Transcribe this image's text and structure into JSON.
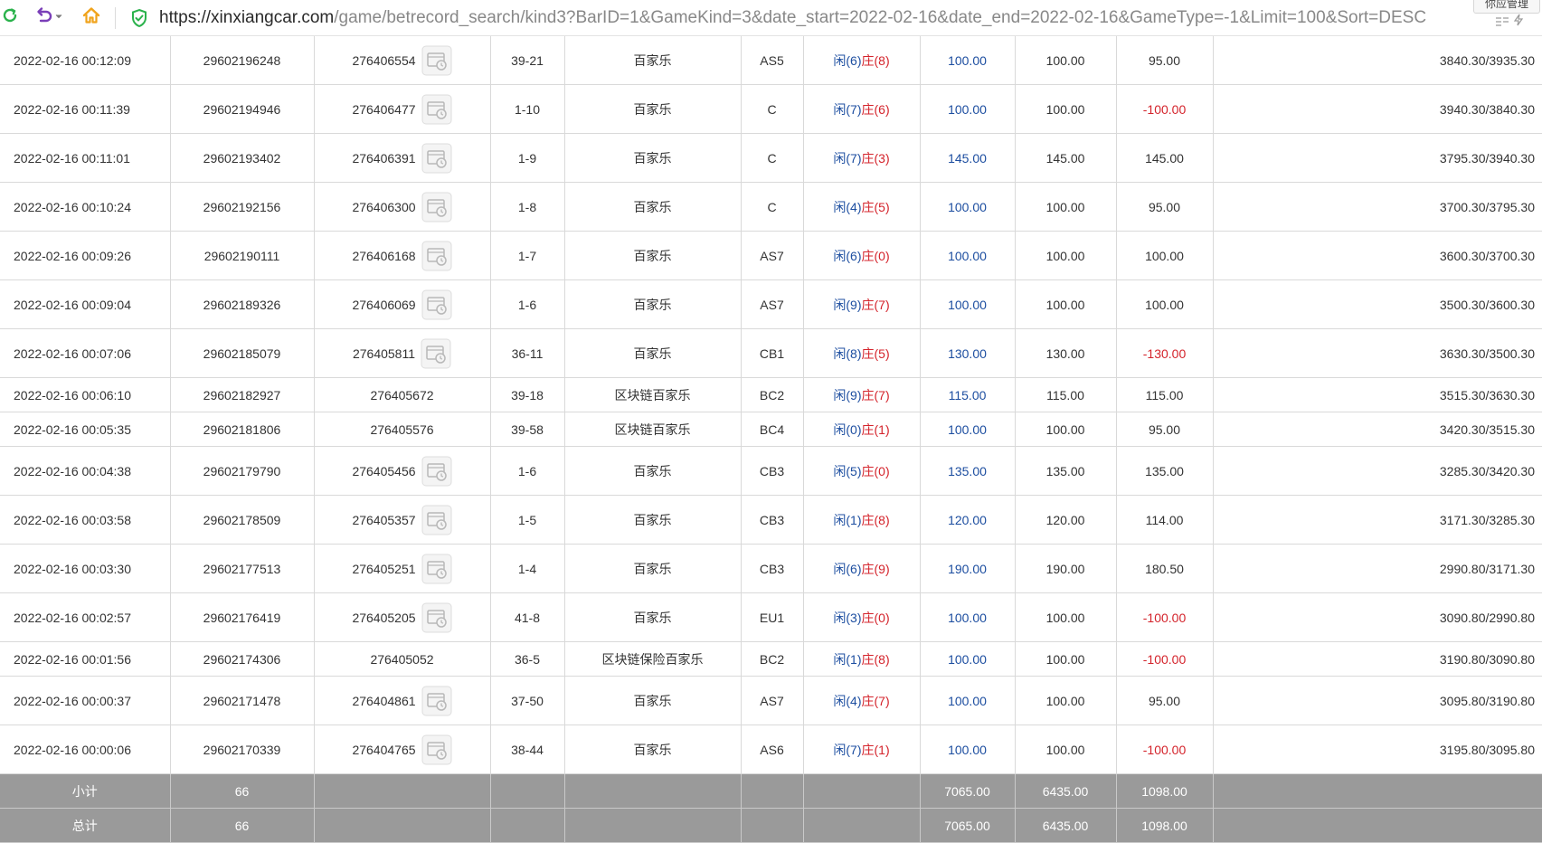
{
  "browser": {
    "url_host": "https://xinxiangcar.com",
    "url_path": "/game/betrecord_search/kind3?BarID=1&GameKind=3&date_start=2022-02-16&date_end=2022-02-16&GameType=-1&Limit=100&Sort=DESC",
    "popup_label": "你应管理",
    "icons": {
      "reload": "reload-icon",
      "undo": "undo-icon",
      "home": "home-icon",
      "security": "shield-check-icon"
    },
    "colors": {
      "reload": "#2bb24c",
      "undo": "#7a3fb8",
      "home": "#f0a31c",
      "shield": "#2bb24c"
    }
  },
  "colors": {
    "bet": "#1d4ea0",
    "loss": "#d4232b",
    "player": "#1d4ea0",
    "banker": "#d4232b",
    "summary_bg": "#9a9a9a"
  },
  "rows": [
    {
      "time": "2022-02-16 00:12:09",
      "order": "29602196248",
      "round": "276406554",
      "has_icon": true,
      "shoe": "39-21",
      "game": "百家乐",
      "table": "AS5",
      "player": "闲(6)",
      "banker": "庄(8)",
      "bet": "100.00",
      "valid": "100.00",
      "win": "95.00",
      "balance": "3840.30/3935.30"
    },
    {
      "time": "2022-02-16 00:11:39",
      "order": "29602194946",
      "round": "276406477",
      "has_icon": true,
      "shoe": "1-10",
      "game": "百家乐",
      "table": "C",
      "player": "闲(7)",
      "banker": "庄(6)",
      "bet": "100.00",
      "valid": "100.00",
      "win": "-100.00",
      "balance": "3940.30/3840.30"
    },
    {
      "time": "2022-02-16 00:11:01",
      "order": "29602193402",
      "round": "276406391",
      "has_icon": true,
      "shoe": "1-9",
      "game": "百家乐",
      "table": "C",
      "player": "闲(7)",
      "banker": "庄(3)",
      "bet": "145.00",
      "valid": "145.00",
      "win": "145.00",
      "balance": "3795.30/3940.30"
    },
    {
      "time": "2022-02-16 00:10:24",
      "order": "29602192156",
      "round": "276406300",
      "has_icon": true,
      "shoe": "1-8",
      "game": "百家乐",
      "table": "C",
      "player": "闲(4)",
      "banker": "庄(5)",
      "bet": "100.00",
      "valid": "100.00",
      "win": "95.00",
      "balance": "3700.30/3795.30"
    },
    {
      "time": "2022-02-16 00:09:26",
      "order": "29602190111",
      "round": "276406168",
      "has_icon": true,
      "shoe": "1-7",
      "game": "百家乐",
      "table": "AS7",
      "player": "闲(6)",
      "banker": "庄(0)",
      "bet": "100.00",
      "valid": "100.00",
      "win": "100.00",
      "balance": "3600.30/3700.30"
    },
    {
      "time": "2022-02-16 00:09:04",
      "order": "29602189326",
      "round": "276406069",
      "has_icon": true,
      "shoe": "1-6",
      "game": "百家乐",
      "table": "AS7",
      "player": "闲(9)",
      "banker": "庄(7)",
      "bet": "100.00",
      "valid": "100.00",
      "win": "100.00",
      "balance": "3500.30/3600.30"
    },
    {
      "time": "2022-02-16 00:07:06",
      "order": "29602185079",
      "round": "276405811",
      "has_icon": true,
      "shoe": "36-11",
      "game": "百家乐",
      "table": "CB1",
      "player": "闲(8)",
      "banker": "庄(5)",
      "bet": "130.00",
      "valid": "130.00",
      "win": "-130.00",
      "balance": "3630.30/3500.30"
    },
    {
      "time": "2022-02-16 00:06:10",
      "order": "29602182927",
      "round": "276405672",
      "has_icon": false,
      "shoe": "39-18",
      "game": "区块链百家乐",
      "table": "BC2",
      "player": "闲(9)",
      "banker": "庄(7)",
      "bet": "115.00",
      "valid": "115.00",
      "win": "115.00",
      "balance": "3515.30/3630.30"
    },
    {
      "time": "2022-02-16 00:05:35",
      "order": "29602181806",
      "round": "276405576",
      "has_icon": false,
      "shoe": "39-58",
      "game": "区块链百家乐",
      "table": "BC4",
      "player": "闲(0)",
      "banker": "庄(1)",
      "bet": "100.00",
      "valid": "100.00",
      "win": "95.00",
      "balance": "3420.30/3515.30"
    },
    {
      "time": "2022-02-16 00:04:38",
      "order": "29602179790",
      "round": "276405456",
      "has_icon": true,
      "shoe": "1-6",
      "game": "百家乐",
      "table": "CB3",
      "player": "闲(5)",
      "banker": "庄(0)",
      "bet": "135.00",
      "valid": "135.00",
      "win": "135.00",
      "balance": "3285.30/3420.30"
    },
    {
      "time": "2022-02-16 00:03:58",
      "order": "29602178509",
      "round": "276405357",
      "has_icon": true,
      "shoe": "1-5",
      "game": "百家乐",
      "table": "CB3",
      "player": "闲(1)",
      "banker": "庄(8)",
      "bet": "120.00",
      "valid": "120.00",
      "win": "114.00",
      "balance": "3171.30/3285.30"
    },
    {
      "time": "2022-02-16 00:03:30",
      "order": "29602177513",
      "round": "276405251",
      "has_icon": true,
      "shoe": "1-4",
      "game": "百家乐",
      "table": "CB3",
      "player": "闲(6)",
      "banker": "庄(9)",
      "bet": "190.00",
      "valid": "190.00",
      "win": "180.50",
      "balance": "2990.80/3171.30"
    },
    {
      "time": "2022-02-16 00:02:57",
      "order": "29602176419",
      "round": "276405205",
      "has_icon": true,
      "shoe": "41-8",
      "game": "百家乐",
      "table": "EU1",
      "player": "闲(3)",
      "banker": "庄(0)",
      "bet": "100.00",
      "valid": "100.00",
      "win": "-100.00",
      "balance": "3090.80/2990.80"
    },
    {
      "time": "2022-02-16 00:01:56",
      "order": "29602174306",
      "round": "276405052",
      "has_icon": false,
      "shoe": "36-5",
      "game": "区块链保险百家乐",
      "table": "BC2",
      "player": "闲(1)",
      "banker": "庄(8)",
      "bet": "100.00",
      "valid": "100.00",
      "win": "-100.00",
      "balance": "3190.80/3090.80"
    },
    {
      "time": "2022-02-16 00:00:37",
      "order": "29602171478",
      "round": "276404861",
      "has_icon": true,
      "shoe": "37-50",
      "game": "百家乐",
      "table": "AS7",
      "player": "闲(4)",
      "banker": "庄(7)",
      "bet": "100.00",
      "valid": "100.00",
      "win": "95.00",
      "balance": "3095.80/3190.80"
    },
    {
      "time": "2022-02-16 00:00:06",
      "order": "29602170339",
      "round": "276404765",
      "has_icon": true,
      "shoe": "38-44",
      "game": "百家乐",
      "table": "AS6",
      "player": "闲(7)",
      "banker": "庄(1)",
      "bet": "100.00",
      "valid": "100.00",
      "win": "-100.00",
      "balance": "3195.80/3095.80"
    }
  ],
  "summary": [
    {
      "label": "小计",
      "count": "66",
      "bet": "7065.00",
      "valid": "6435.00",
      "win": "1098.00"
    },
    {
      "label": "总计",
      "count": "66",
      "bet": "7065.00",
      "valid": "6435.00",
      "win": "1098.00"
    }
  ]
}
